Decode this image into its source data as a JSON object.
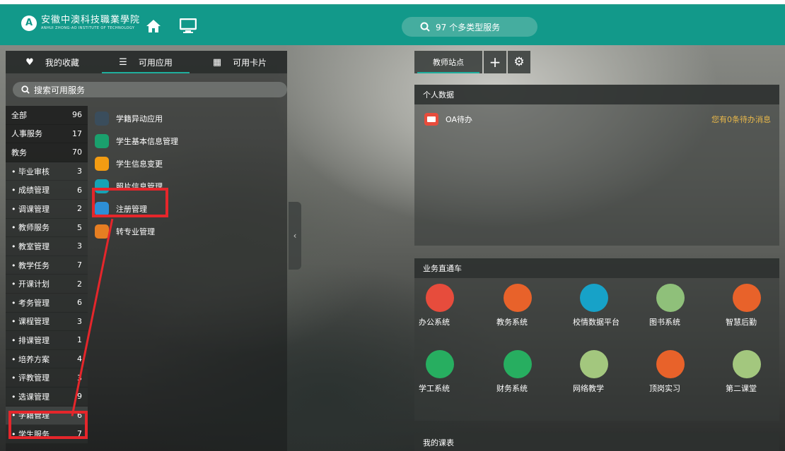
{
  "header": {
    "logo_cn": "安徽中澳科技職業學院",
    "logo_en": "ANHUI ZHONG-AO INSTITUTE OF TECHNOLOGY",
    "search_text": "97 个多类型服务"
  },
  "left_tabs": [
    {
      "icon": "heart-icon",
      "label": "我的收藏"
    },
    {
      "icon": "list-icon",
      "label": "可用应用"
    },
    {
      "icon": "grid-icon",
      "label": "可用卡片"
    }
  ],
  "left_search_placeholder": "搜索可用服务",
  "categories": [
    {
      "name": "全部",
      "count": "96"
    },
    {
      "name": "人事服务",
      "count": "17"
    },
    {
      "name": "教务",
      "count": "70"
    },
    {
      "name": "毕业审核",
      "count": "3"
    },
    {
      "name": "成绩管理",
      "count": "6"
    },
    {
      "name": "调课管理",
      "count": "2"
    },
    {
      "name": "教师服务",
      "count": "5"
    },
    {
      "name": "教室管理",
      "count": "3"
    },
    {
      "name": "教学任务",
      "count": "7"
    },
    {
      "name": "开课计划",
      "count": "2"
    },
    {
      "name": "考务管理",
      "count": "6"
    },
    {
      "name": "课程管理",
      "count": "3"
    },
    {
      "name": "排课管理",
      "count": "1"
    },
    {
      "name": "培养方案",
      "count": "4"
    },
    {
      "name": "评教管理",
      "count": "3"
    },
    {
      "name": "选课管理",
      "count": "9"
    },
    {
      "name": "学籍管理",
      "count": "6"
    },
    {
      "name": "学生服务",
      "count": "7"
    }
  ],
  "apps": [
    {
      "label": "学籍异动应用",
      "color": "#3a4d5c"
    },
    {
      "label": "学生基本信息管理",
      "color": "#1aa06d"
    },
    {
      "label": "学生信息变更",
      "color": "#f39c12"
    },
    {
      "label": "照片信息管理",
      "color": "#16a3b5"
    },
    {
      "label": "注册管理",
      "color": "#2d8fd6"
    },
    {
      "label": "转专业管理",
      "color": "#e67e22"
    }
  ],
  "right_tab": "教师站点",
  "personal_card": {
    "title": "个人数据",
    "oa_label": "OA待办",
    "oa_message": "您有0条待办消息"
  },
  "business_card": {
    "title": "业务直通车",
    "items": [
      {
        "label": "办公系统",
        "color": "#e74c3c"
      },
      {
        "label": "教务系统",
        "color": "#e8622a"
      },
      {
        "label": "校情数据平台",
        "color": "#17a2c8"
      },
      {
        "label": "图书系统",
        "color": "#8fc07a"
      },
      {
        "label": "智慧后勤",
        "color": "#e8622a"
      },
      {
        "label": "学工系统",
        "color": "#27ae60"
      },
      {
        "label": "财务系统",
        "color": "#27ae60"
      },
      {
        "label": "网络教学",
        "color": "#a3c77e"
      },
      {
        "label": "顶岗实习",
        "color": "#e8622a"
      },
      {
        "label": "第二课堂",
        "color": "#a3c77e"
      }
    ]
  },
  "course_card": {
    "title": "我的课表"
  },
  "colors": {
    "primary": "#12998a",
    "annotation": "#e5262b",
    "warning": "#e9b84a"
  }
}
